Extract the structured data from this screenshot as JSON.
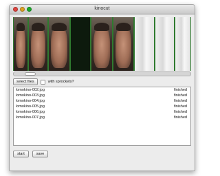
{
  "window": {
    "title": "kinocut"
  },
  "filmstrip": {
    "frames": [
      "photo",
      "photo",
      "photo",
      "dark",
      "photo",
      "photo",
      "white",
      "white",
      "white"
    ]
  },
  "toolbar": {
    "select_files_label": "select files",
    "sprockets_label": "with sprockets?",
    "sprockets_checked": false
  },
  "files": [
    {
      "name": "lomokino-002.jpg",
      "status": "finished"
    },
    {
      "name": "lomokino-003.jpg",
      "status": "finished"
    },
    {
      "name": "lomokino-004.jpg",
      "status": "finished"
    },
    {
      "name": "lomokino-005.jpg",
      "status": "finished"
    },
    {
      "name": "lomokino-006.jpg",
      "status": "finished"
    },
    {
      "name": "lomokino-007.jpg",
      "status": "finished"
    }
  ],
  "actions": {
    "start_label": "start",
    "save_label": "save"
  }
}
